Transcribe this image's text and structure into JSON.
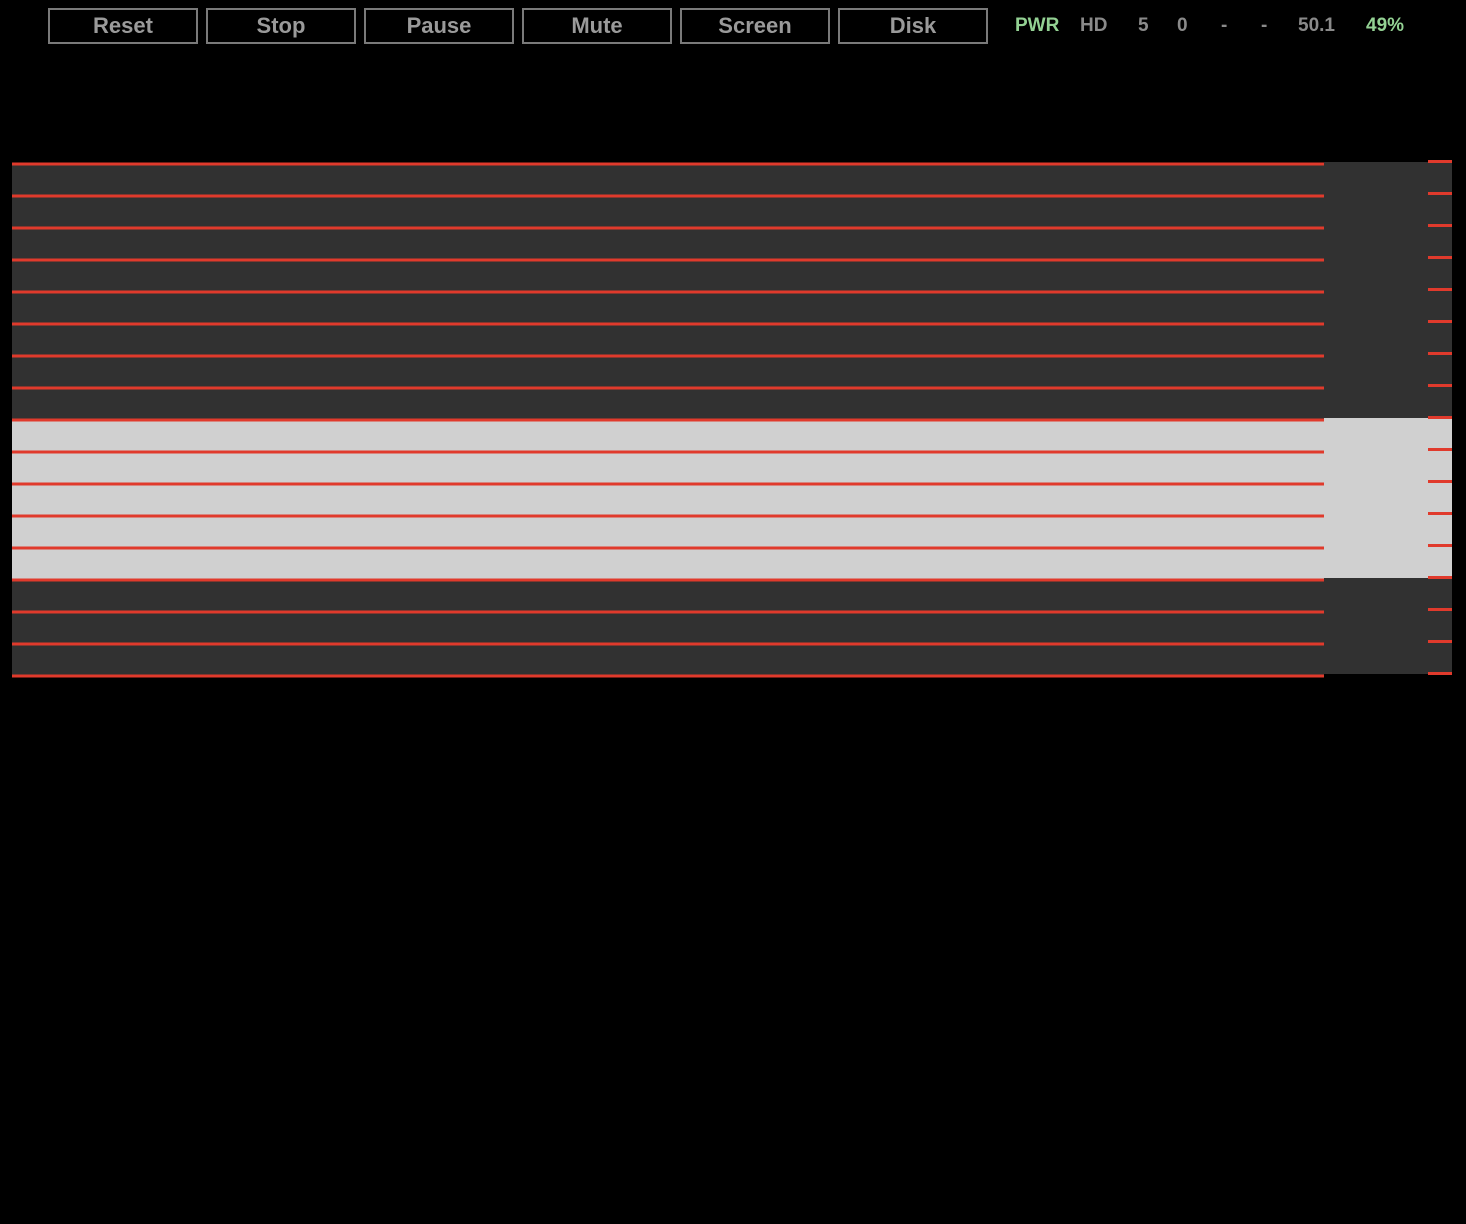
{
  "toolbar": {
    "buttons": [
      {
        "label": "Reset"
      },
      {
        "label": "Stop"
      },
      {
        "label": "Pause"
      },
      {
        "label": "Mute"
      },
      {
        "label": "Screen"
      },
      {
        "label": "Disk"
      }
    ]
  },
  "status": {
    "power": "PWR",
    "hd": "HD",
    "value_a": "5",
    "value_b": "0",
    "value_c": "-",
    "value_d": "-",
    "speed": "50.1",
    "percent": "49%"
  },
  "colors": {
    "background": "#000000",
    "button_border": "#7a7a7a",
    "button_text": "#9a9a9a",
    "status_active": "#93d193",
    "status_inactive": "#8a8a8a",
    "stripe_line": "#e03a2c",
    "band_dark": "#313131",
    "band_light": "#d0d0d0"
  },
  "screen": {
    "line_count": 17,
    "bands": [
      {
        "tone": "dark",
        "from_line": 0,
        "to_line": 8
      },
      {
        "tone": "light",
        "from_line": 8,
        "to_line": 13
      },
      {
        "tone": "dark",
        "from_line": 13,
        "to_line": 16
      }
    ]
  }
}
